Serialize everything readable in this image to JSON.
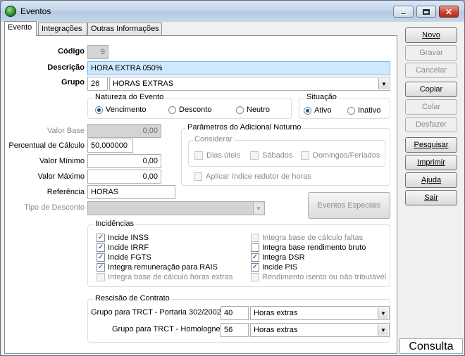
{
  "window": {
    "title": "Eventos"
  },
  "tabs": [
    "Evento",
    "Integrações",
    "Outras Informações"
  ],
  "form": {
    "codigo_label": "Código",
    "codigo_value": "9",
    "descricao_label": "Descrição",
    "descricao_value": "HORA EXTRA 050%",
    "grupo_label": "Grupo",
    "grupo_code": "26",
    "grupo_value": "HORAS EXTRAS",
    "natureza": {
      "title": "Natureza do Evento",
      "options": [
        "Vencimento",
        "Desconto",
        "Neutro"
      ],
      "selected": "Vencimento"
    },
    "situacao": {
      "title": "Situação",
      "options": [
        "Ativo",
        "Inativo"
      ],
      "selected": "Ativo"
    },
    "valor_base_label": "Valor Base",
    "valor_base_value": "0,00",
    "percentual_label": "Percentual de Cálculo",
    "percentual_value": "50,000000",
    "valor_minimo_label": "Valor Mínimo",
    "valor_minimo_value": "0,00",
    "valor_maximo_label": "Valor Máximo",
    "valor_maximo_value": "0,00",
    "referencia_label": "Referência",
    "referencia_value": "HORAS",
    "tipo_desconto_label": "Tipo de Desconto",
    "tipo_desconto_value": ""
  },
  "adicional_noturno": {
    "title": "Parâmetros do Adicional Noturno",
    "considerar_title": "Considerar",
    "options": [
      "Dias úteis",
      "Sábados",
      "Domingos/Feriados"
    ],
    "aplicar_label": "Aplicar índice redutor de horas"
  },
  "eventos_especiais_label": "Eventos Especiais",
  "incidencias": {
    "title": "Incidências",
    "left": [
      {
        "label": "Incide INSS",
        "checked": true,
        "enabled": true
      },
      {
        "label": "Incide IRRF",
        "checked": true,
        "enabled": true
      },
      {
        "label": "Incide FGTS",
        "checked": true,
        "enabled": true
      },
      {
        "label": "Integra remuneração para RAIS",
        "checked": true,
        "enabled": true
      },
      {
        "label": "Integra base de cálculo horas extras",
        "checked": false,
        "enabled": false
      }
    ],
    "right": [
      {
        "label": "Integra base de cálculo faltas",
        "checked": false,
        "enabled": false
      },
      {
        "label": "Integra base rendimento bruto",
        "checked": false,
        "enabled": true
      },
      {
        "label": "Integra DSR",
        "checked": true,
        "enabled": true
      },
      {
        "label": "Incide PIS",
        "checked": true,
        "enabled": true
      },
      {
        "label": "Rendimento isento ou não tributável",
        "checked": false,
        "enabled": false
      }
    ]
  },
  "rescisao": {
    "title": "Rescisão de Contrato",
    "portaria_label": "Grupo para TRCT - Portaria 302/2002",
    "portaria_code": "40",
    "portaria_value": "Horas extras",
    "homolognet_label": "Grupo para TRCT - Homolognet",
    "homolognet_code": "56",
    "homolognet_value": "Horas extras"
  },
  "side_buttons": [
    {
      "label": "Novo",
      "enabled": true
    },
    {
      "label": "Gravar",
      "enabled": false
    },
    {
      "label": "Cancelar",
      "enabled": false
    },
    {
      "label": "Copiar",
      "enabled": true
    },
    {
      "label": "Colar",
      "enabled": false
    },
    {
      "label": "Desfazer",
      "enabled": false
    },
    {
      "label": "Pesquisar",
      "enabled": true
    },
    {
      "label": "Imprimir",
      "enabled": true
    },
    {
      "label": "Ajuda",
      "enabled": true
    },
    {
      "label": "Sair",
      "enabled": true
    }
  ],
  "status": "Consulta"
}
